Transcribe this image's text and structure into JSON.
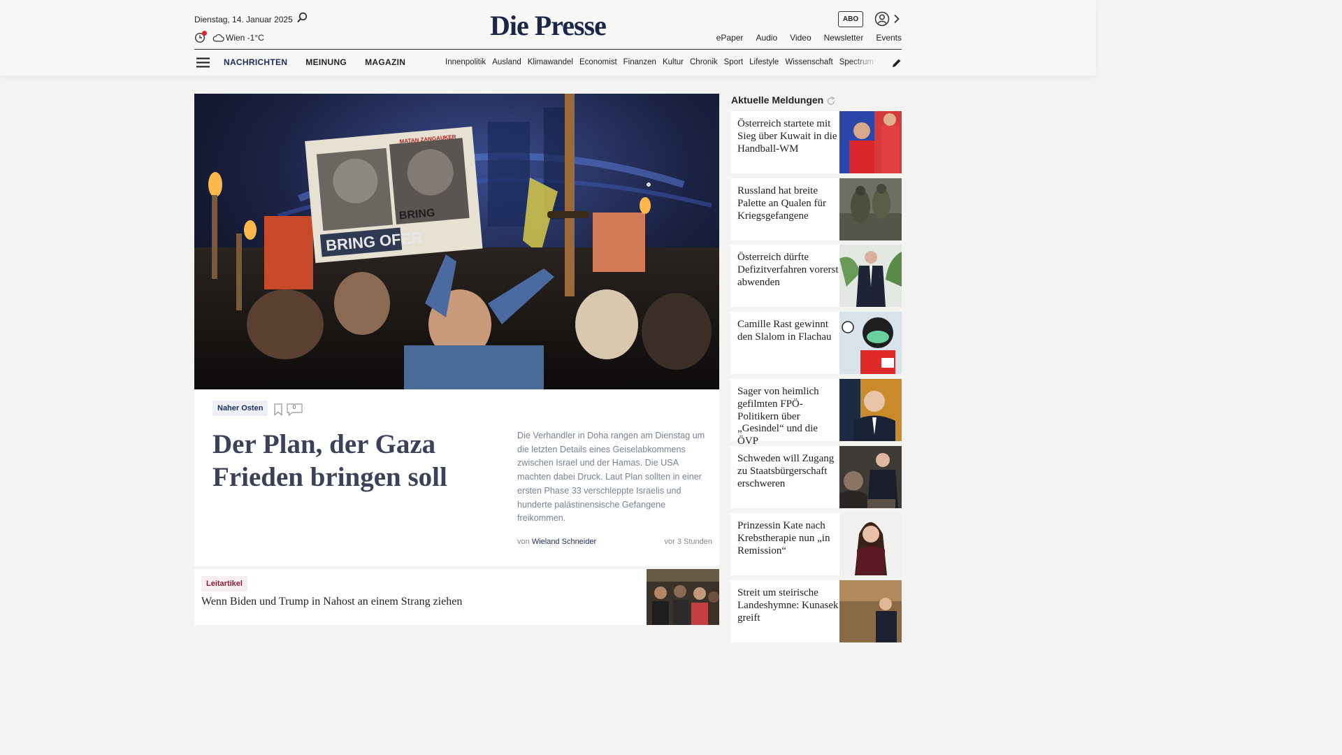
{
  "header": {
    "date": "Dienstag, 14. Januar 2025",
    "weather": "Wien -1°C",
    "logo": "Die Presse",
    "abo_label": "ABO",
    "top_links": [
      "ePaper",
      "Audio",
      "Video",
      "Newsletter",
      "Events"
    ]
  },
  "nav": {
    "main": [
      "NACHRICHTEN",
      "MEINUNG",
      "MAGAZIN"
    ],
    "active": "NACHRICHTEN",
    "sections": [
      "Innenpolitik",
      "Ausland",
      "Klimawandel",
      "Economist",
      "Finanzen",
      "Kultur",
      "Chronik",
      "Sport",
      "Lifestyle",
      "Wissenschaft",
      "Spectrum"
    ]
  },
  "lead": {
    "category": "Naher Osten",
    "comments": "0",
    "title": "Der Plan, der Gaza Frieden bringen soll",
    "teaser": "Die Verhandler in Doha rangen am Dienstag um die letzten Details eines Geiselabkommens zwischen Israel und der Hamas. Die USA machten dabei Druck. Laut Plan sollten in einer ersten Phase 33 verschleppte Israelis und hunderte palästinensische Gefangene freikommen.",
    "byline_prefix": "von",
    "author": "Wieland Schneider",
    "time": "vor 3 Stunden",
    "photo_sign_text": "BRING OFER",
    "photo_sign_text_2": "BRING",
    "photo_sign_name": "MATAN ZANGAUKER"
  },
  "second": {
    "category": "Leitartikel",
    "title": "Wenn Biden und Trump in Nahost an einem Strang ziehen"
  },
  "sidebar": {
    "heading": "Aktuelle Meldungen",
    "items": [
      {
        "title": "Österreich startete mit Sieg über Kuwait in die Handball-WM"
      },
      {
        "title": "Russland hat breite Palette an Qualen für Kriegsgefangene"
      },
      {
        "title": "Österreich dürfte Defizitverfahren vorerst abwenden"
      },
      {
        "title": "Camille Rast gewinnt den Slalom in Flachau"
      },
      {
        "title": "Sager von heimlich gefilmten FPÖ-Politikern über „Gesindel“ und die ÖVP"
      },
      {
        "title": "Schweden will Zugang zu Staatsbürgerschaft erschweren"
      },
      {
        "title": "Prinzessin Kate nach Krebstherapie nun „in Remission“"
      },
      {
        "title": "Streit um steirische Landeshymne: Kunasek greift"
      }
    ]
  },
  "colors": {
    "brand": "#1a2746",
    "accent_red": "#e0202a",
    "leitartikel": "#8a1d3a"
  }
}
